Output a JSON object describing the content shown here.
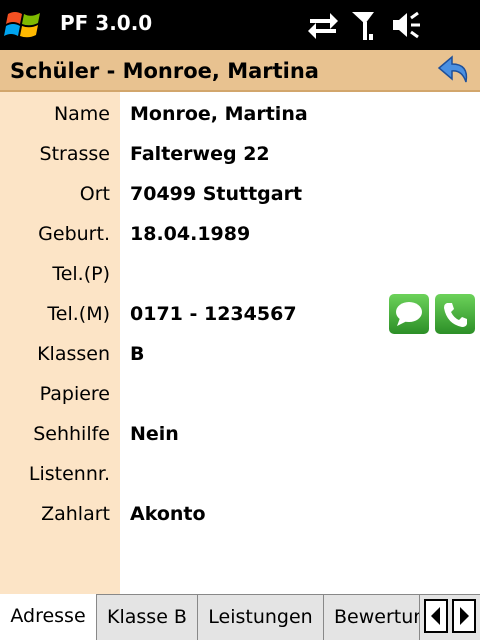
{
  "statusbar": {
    "app_title": "PF 3.0.0",
    "icons": [
      "windows-start-icon",
      "sync-arrows-icon",
      "signal-antenna-icon",
      "speaker-volume-icon"
    ]
  },
  "header": {
    "title": "Schüler - Monroe, Martina",
    "back_icon": "back-arrow-icon"
  },
  "fields": [
    {
      "label": "Name",
      "value": "Monroe, Martina"
    },
    {
      "label": "Strasse",
      "value": "Falterweg 22"
    },
    {
      "label": "Ort",
      "value": "70499 Stuttgart"
    },
    {
      "label": "Geburt.",
      "value": "18.04.1989"
    },
    {
      "label": "Tel.(P)",
      "value": ""
    },
    {
      "label": "Tel.(M)",
      "value": "0171 - 1234567"
    },
    {
      "label": "Klassen",
      "value": "B"
    },
    {
      "label": "Papiere",
      "value": ""
    },
    {
      "label": "Sehhilfe",
      "value": "Nein"
    },
    {
      "label": "Listennr.",
      "value": ""
    },
    {
      "label": "Zahlart",
      "value": "Akonto"
    }
  ],
  "actions": {
    "sms_icon": "sms-bubble-icon",
    "call_icon": "phone-call-icon"
  },
  "tabs": [
    {
      "label": "Adresse",
      "active": true
    },
    {
      "label": "Klasse B",
      "active": false
    },
    {
      "label": "Leistungen",
      "active": false
    },
    {
      "label": "Bewertungen",
      "active": false
    }
  ],
  "colors": {
    "header_bg": "#e8c290",
    "label_column_bg": "#fce4c6",
    "action_green": "#3aa634"
  }
}
